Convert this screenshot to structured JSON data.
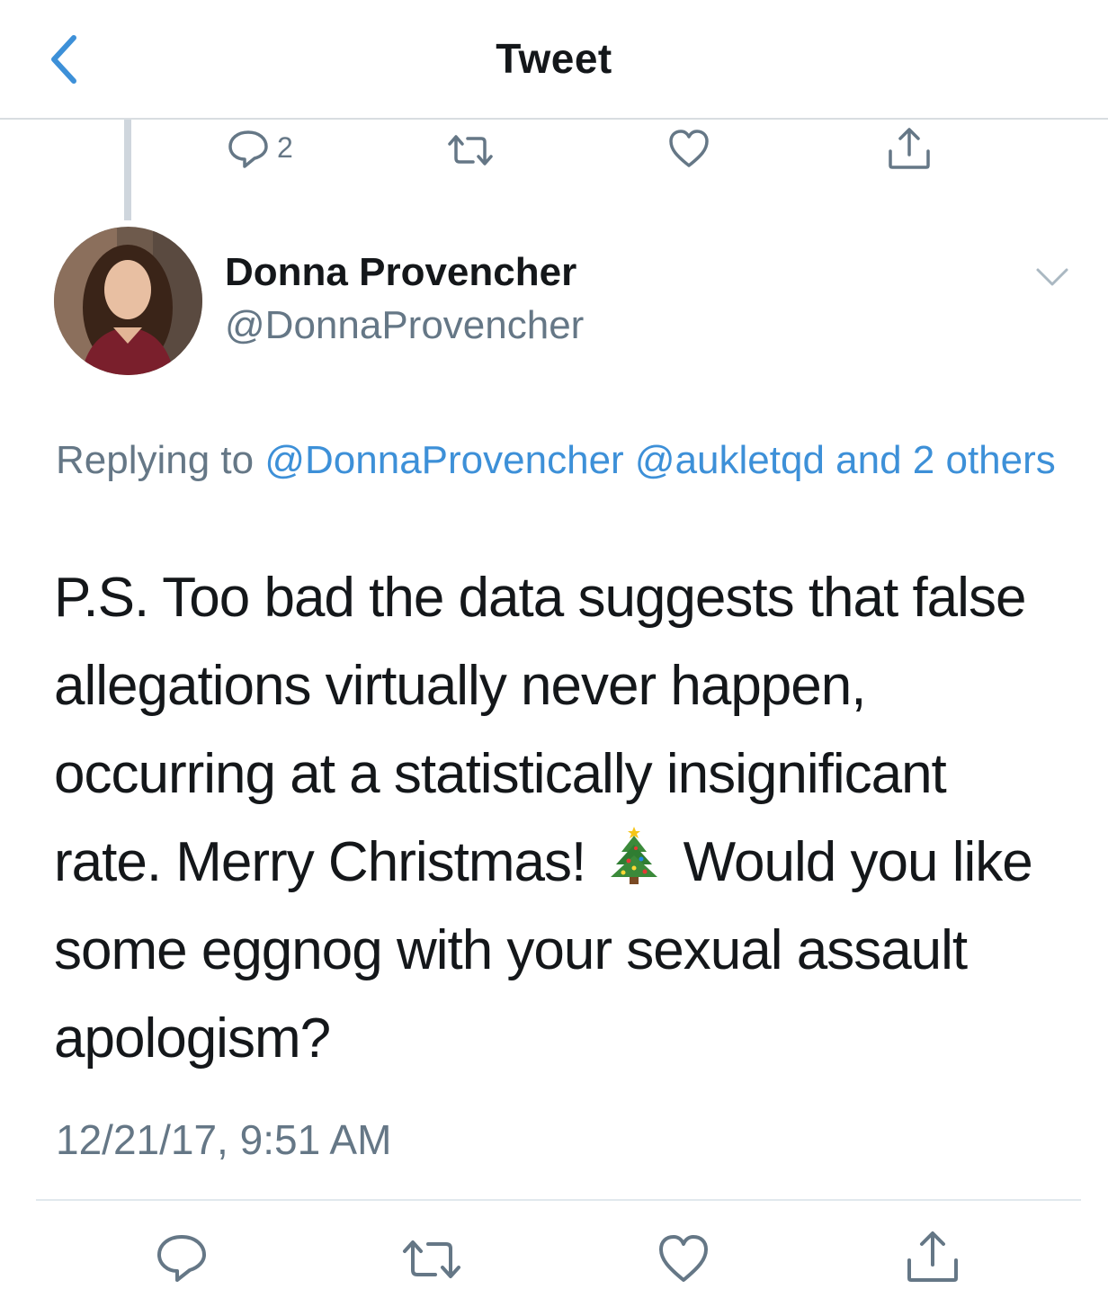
{
  "navbar": {
    "title": "Tweet"
  },
  "parent_actions": {
    "reply_count": "2"
  },
  "tweet": {
    "display_name": "Donna Provencher",
    "handle": "@DonnaProvencher",
    "replying_prefix": "Replying to ",
    "replying_mentions": "@DonnaProvencher @aukletqd and 2 others",
    "text_before_emoji": "P.S. Too bad the data suggests that false allegations virtually never happen, occurring at a statistically insignificant rate.  Merry Christmas!",
    "emoji_name": "christmas-tree-emoji",
    "text_after_emoji": " Would you like some eggnog with your sexual assault apologism?",
    "timestamp": "12/21/17, 9:51 AM"
  },
  "icons": {
    "back": "chevron-left-icon",
    "reply": "speech-bubble-icon",
    "retweet": "retweet-icon",
    "like": "heart-icon",
    "share": "share-upload-icon",
    "more": "chevron-down-icon"
  },
  "colors": {
    "accent": "#3d90d8",
    "secondary_text": "#657786",
    "primary_text": "#14171a",
    "thread_line": "#cfd6dd",
    "divider": "#e1e8ed"
  }
}
